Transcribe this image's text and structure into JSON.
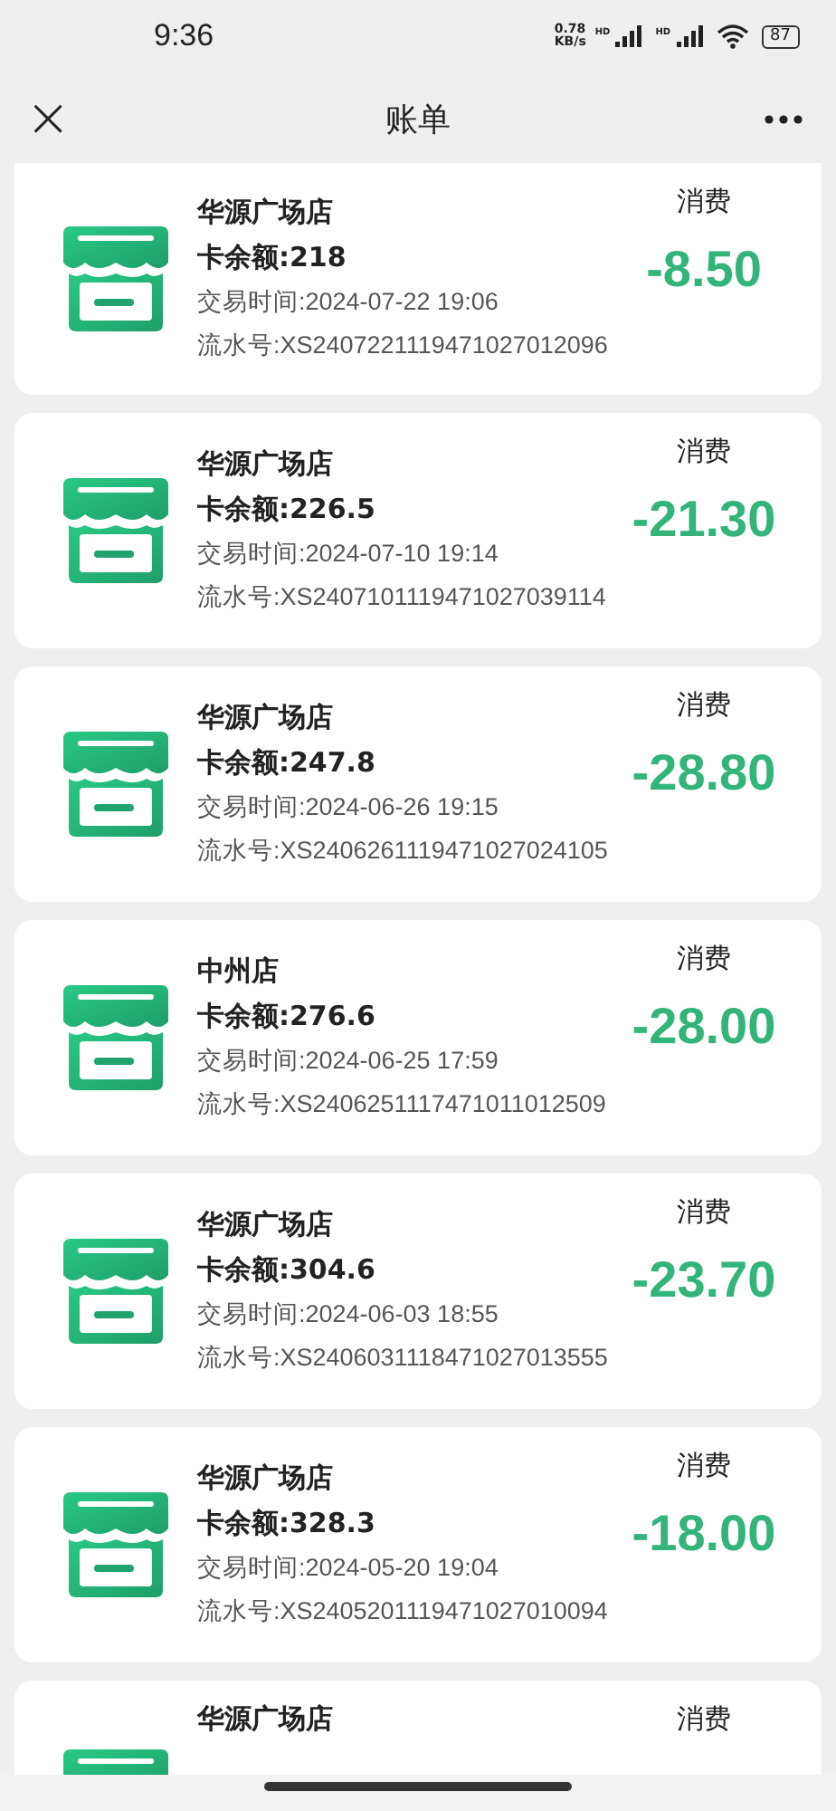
{
  "status_bar": {
    "time": "9:36",
    "net_speed": [
      "0.78",
      "KB/s"
    ],
    "sim_labels": [
      "HD",
      "HD"
    ],
    "battery": "87"
  },
  "header": {
    "title": "账单",
    "close_icon": "×"
  },
  "records": [
    {
      "store": "华源广场店",
      "type": "消费",
      "balance": "卡余额:218",
      "amount": "-8.50",
      "time": "交易时间:2024-07-22 19:06",
      "serial": "流水号:XS2407221119471027012096"
    },
    {
      "store": "华源广场店",
      "type": "消费",
      "balance": "卡余额:226.5",
      "amount": "-21.30",
      "time": "交易时间:2024-07-10 19:14",
      "serial": "流水号:XS2407101119471027039114"
    },
    {
      "store": "华源广场店",
      "type": "消费",
      "balance": "卡余额:247.8",
      "amount": "-28.80",
      "time": "交易时间:2024-06-26 19:15",
      "serial": "流水号:XS2406261119471027024105"
    },
    {
      "store": "中州店",
      "type": "消费",
      "balance": "卡余额:276.6",
      "amount": "-28.00",
      "time": "交易时间:2024-06-25 17:59",
      "serial": "流水号:XS2406251117471011012509"
    },
    {
      "store": "华源广场店",
      "type": "消费",
      "balance": "卡余额:304.6",
      "amount": "-23.70",
      "time": "交易时间:2024-06-03 18:55",
      "serial": "流水号:XS2406031118471027013555"
    },
    {
      "store": "华源广场店",
      "type": "消费",
      "balance": "卡余额:328.3",
      "amount": "-18.00",
      "time": "交易时间:2024-05-20 19:04",
      "serial": "流水号:XS2405201119471027010094"
    },
    {
      "store": "华源广场店",
      "type": "消费"
    }
  ]
}
